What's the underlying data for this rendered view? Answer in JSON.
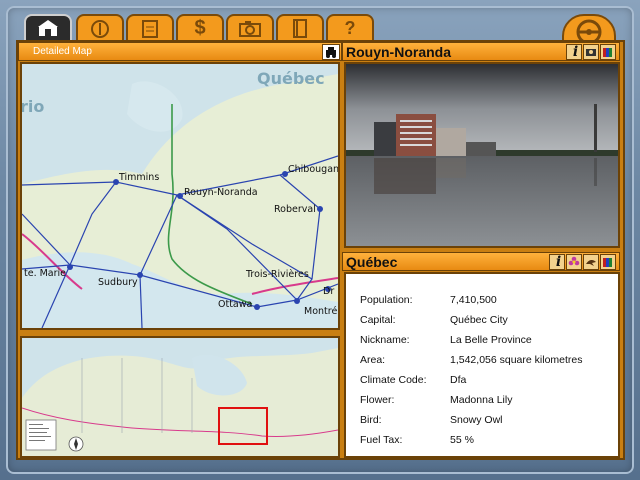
{
  "map_panel": {
    "title": "Detailed Map"
  },
  "map": {
    "region_labels": [
      "Québec",
      "rio"
    ],
    "cities": [
      "Timmins",
      "Rouyn-Noranda",
      "Chibougamau",
      "Roberval",
      "Sudbury",
      "Trois-Rivières",
      "Ottawa",
      "Montréal",
      "Sault Ste. Marie",
      "Drummondville"
    ],
    "city_display": {
      "timmins": "Timmins",
      "rouyn": "Rouyn-Noranda",
      "chibougamau": "Chibougan",
      "roberval": "Roberval",
      "sudbury": "Sudbury",
      "trois": "Trois-Rivières",
      "ottawa": "Ottawa",
      "montreal": "Montré",
      "saultmarie": "te. Marie",
      "drummond": "Dr"
    },
    "colors": {
      "water": "#cfe3ea",
      "land": "#e8eed8",
      "road": "#2a44b0",
      "rail": "#3c9a4a",
      "border": "#d83a8c"
    }
  },
  "city_panel": {
    "title": "Rouyn-Noranda",
    "photo_alt": "city-waterfront-photo"
  },
  "province_panel": {
    "title": "Québec",
    "facts": [
      {
        "label": "Population:",
        "value": "7,410,500"
      },
      {
        "label": "Capital:",
        "value": "Québec City"
      },
      {
        "label": "Nickname:",
        "value": "La Belle Province"
      },
      {
        "label": "Area:",
        "value": "1,542,056 square kilometres"
      },
      {
        "label": "Climate Code:",
        "value": "Dfa"
      },
      {
        "label": "Flower:",
        "value": "Madonna Lily"
      },
      {
        "label": "Bird:",
        "value": "Snowy Owl"
      },
      {
        "label": "Fuel Tax:",
        "value": "55 %"
      }
    ]
  },
  "tabs": [
    {
      "name": "home-tab",
      "icon": "home-icon"
    },
    {
      "name": "compass-tab",
      "icon": "compass-icon"
    },
    {
      "name": "clipboard-tab",
      "icon": "clipboard-icon"
    },
    {
      "name": "money-tab",
      "icon": "dollar-icon"
    },
    {
      "name": "camera-tab",
      "icon": "camera-icon"
    },
    {
      "name": "book-tab",
      "icon": "book-icon"
    },
    {
      "name": "help-tab",
      "icon": "question-icon"
    }
  ],
  "icons": {
    "info": "i",
    "dollar": "$",
    "help": "?"
  }
}
